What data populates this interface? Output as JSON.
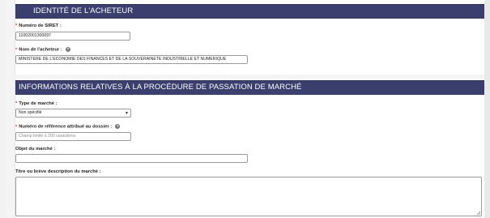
{
  "section1": {
    "title": "IDENTITÉ DE L'ACHETEUR",
    "siret_label": "Numéro de SIRET :",
    "siret_value": "11002001300097",
    "buyer_name_label": "Nom de l'acheteur :",
    "buyer_name_value": "MINISTERE DE L'ECONOMIE DES FINANCES ET DE LA SOUVERAINETE INDUSTRIELLE ET NUMERIQUE"
  },
  "section2": {
    "title": "INFORMATIONS RELATIVES À LA PROCÉDURE DE PASSATION DE MARCHÉ",
    "market_type_label": "Type de marché :",
    "market_type_value": "Non spécifié",
    "reference_label": "Numéro de référence attribué au dossier :",
    "reference_placeholder": "Champ limité à 200 caractères",
    "object_label": "Objet du marché :",
    "object_value": "",
    "description_label": "Titre ou brève description du marché :"
  },
  "icons": {
    "help": "question-circle-icon",
    "dropdown": "chevron-down-icon",
    "resize": "resize-handle-icon"
  },
  "colors": {
    "header_bg": "#3a3f6e",
    "required": "#c0392b"
  }
}
